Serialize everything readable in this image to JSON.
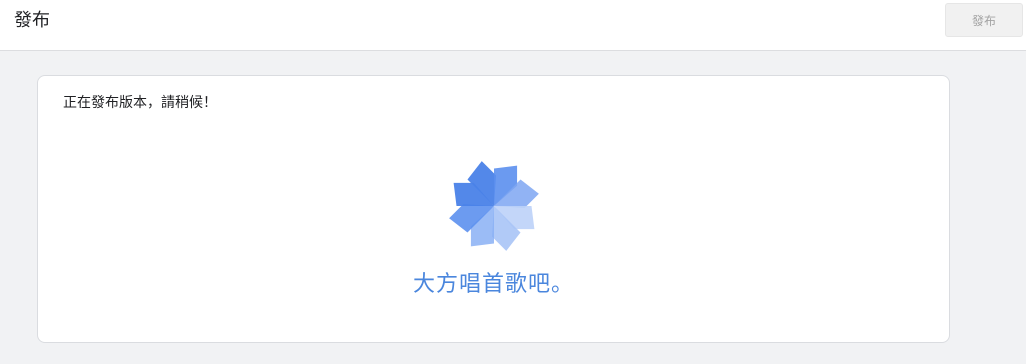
{
  "header": {
    "title": "發布",
    "publish_button_label": "發布"
  },
  "main": {
    "status_message": "正在發布版本，請稍候！",
    "loading_caption": "大方唱首歌吧。"
  },
  "colors": {
    "accent": "#4a86dd",
    "loader_dark": "#4a82e8",
    "loader_light": "#bdd2f8"
  },
  "icons": {
    "loader": "pinwheel-loader-icon"
  }
}
